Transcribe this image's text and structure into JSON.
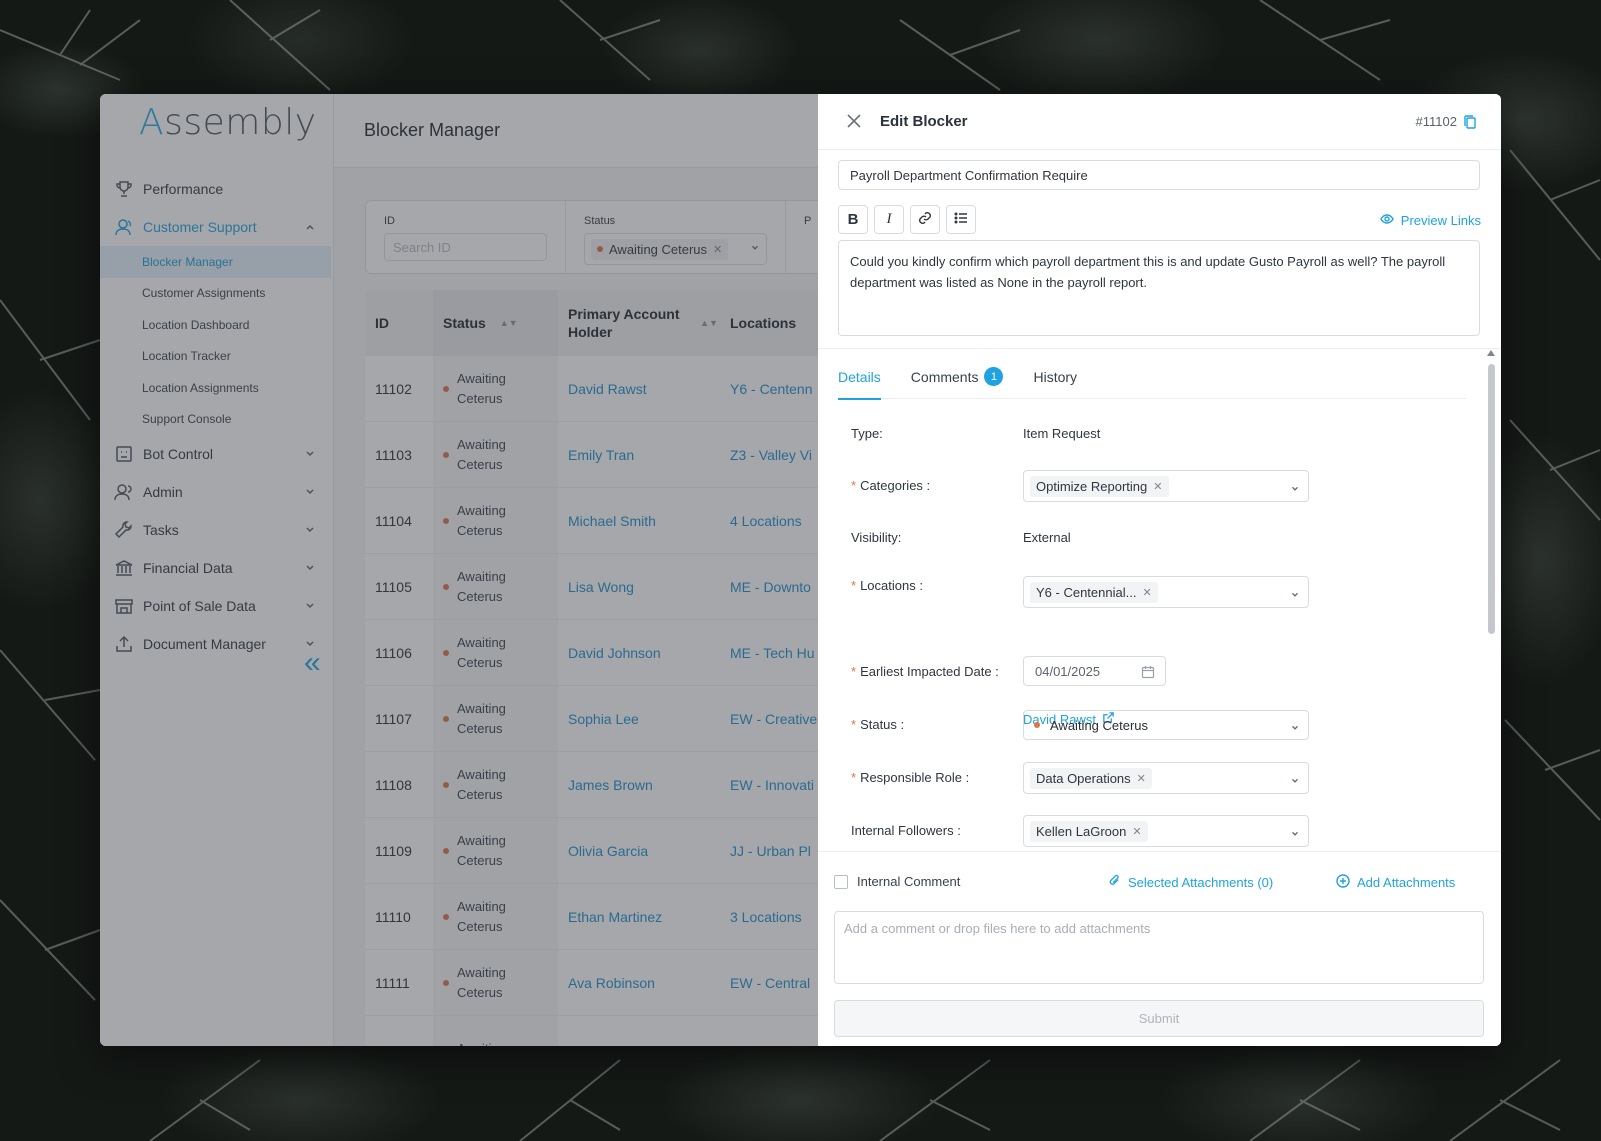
{
  "colors": {
    "accent": "#1fa3e0",
    "status_dot": "#e0734a",
    "overlay": "#3c4046"
  },
  "sidebar": {
    "logo": "Assembly",
    "items": [
      {
        "label": "Performance",
        "icon": "trophy-icon"
      },
      {
        "label": "Customer Support",
        "icon": "headset-icon",
        "active": true,
        "children": [
          "Blocker Manager",
          "Customer Assignments",
          "Location Dashboard",
          "Location Tracker",
          "Location Assignments",
          "Support Console"
        ]
      },
      {
        "label": "Bot Control",
        "icon": "bot-icon"
      },
      {
        "label": "Admin",
        "icon": "users-icon"
      },
      {
        "label": "Tasks",
        "icon": "wrench-icon"
      },
      {
        "label": "Financial Data",
        "icon": "bank-icon"
      },
      {
        "label": "Point of Sale Data",
        "icon": "store-icon"
      },
      {
        "label": "Document Manager",
        "icon": "upload-icon"
      }
    ],
    "collapse": "«"
  },
  "main": {
    "title": "Blocker Manager",
    "filters": {
      "id_label": "ID",
      "id_placeholder": "Search ID",
      "status_label": "Status",
      "status_value": "Awaiting Ceterus",
      "more_label": "P"
    },
    "table": {
      "headers": [
        "ID",
        "Status",
        "Primary Account Holder",
        "Locations"
      ],
      "rows": [
        {
          "id": "11102",
          "status": "Awaiting Ceterus",
          "holder": "David Rawst",
          "location": "Y6 - Centenn"
        },
        {
          "id": "11103",
          "status": "Awaiting Ceterus",
          "holder": "Emily Tran",
          "location": "Z3 - Valley Vi"
        },
        {
          "id": "11104",
          "status": "Awaiting Ceterus",
          "holder": "Michael Smith",
          "location": "4 Locations"
        },
        {
          "id": "11105",
          "status": "Awaiting Ceterus",
          "holder": "Lisa Wong",
          "location": "ME - Downto"
        },
        {
          "id": "11106",
          "status": "Awaiting Ceterus",
          "holder": "David Johnson",
          "location": "ME - Tech Hu"
        },
        {
          "id": "11107",
          "status": "Awaiting Ceterus",
          "holder": "Sophia Lee",
          "location": "EW - Creative"
        },
        {
          "id": "11108",
          "status": "Awaiting Ceterus",
          "holder": "James Brown",
          "location": "EW - Innovati"
        },
        {
          "id": "11109",
          "status": "Awaiting Ceterus",
          "holder": "Olivia Garcia",
          "location": "JJ - Urban Pl"
        },
        {
          "id": "11110",
          "status": "Awaiting Ceterus",
          "holder": "Ethan Martinez",
          "location": "3 Locations"
        },
        {
          "id": "11111",
          "status": "Awaiting Ceterus",
          "holder": "Ava Robinson",
          "location": "EW - Central"
        },
        {
          "id": "",
          "status": "Awaiting",
          "holder": "",
          "location": ""
        }
      ]
    }
  },
  "drawer": {
    "title": "Edit Blocker",
    "ticket_id": "#11102",
    "title_value": "Payroll Department Confirmation Require",
    "toolbar": {
      "bold": "B",
      "italic": "I"
    },
    "preview_links": "Preview Links",
    "description": "Could you kindly confirm which payroll department this is and update Gusto Payroll as well? The payroll department was listed as None in the payroll report.",
    "tabs": [
      {
        "label": "Details",
        "active": true
      },
      {
        "label": "Comments",
        "badge": "1"
      },
      {
        "label": "History"
      }
    ],
    "fields": {
      "type_label": "Type:",
      "type_value": "Item Request",
      "categories_label": "Categories :",
      "categories_value": "Optimize Reporting",
      "visibility_label": "Visibility:",
      "visibility_value": "External",
      "locations_label": "Locations :",
      "locations_value": "Y6 - Centennial...",
      "account_link": "David Rawst",
      "date_label": "Earliest Impacted Date :",
      "date_value": "04/01/2025",
      "status_label": "Status :",
      "status_value": "Awaiting Ceterus",
      "role_label": "Responsible Role :",
      "role_value": "Data Operations",
      "followers_label": "Internal Followers :",
      "followers_value": "Kellen LaGroon"
    },
    "footer": {
      "internal_comment": "Internal Comment",
      "selected_attachments": "Selected Attachments (0)",
      "add_attachments": "Add Attachments",
      "comment_placeholder": "Add a comment or drop files here to add attachments",
      "submit": "Submit"
    }
  }
}
